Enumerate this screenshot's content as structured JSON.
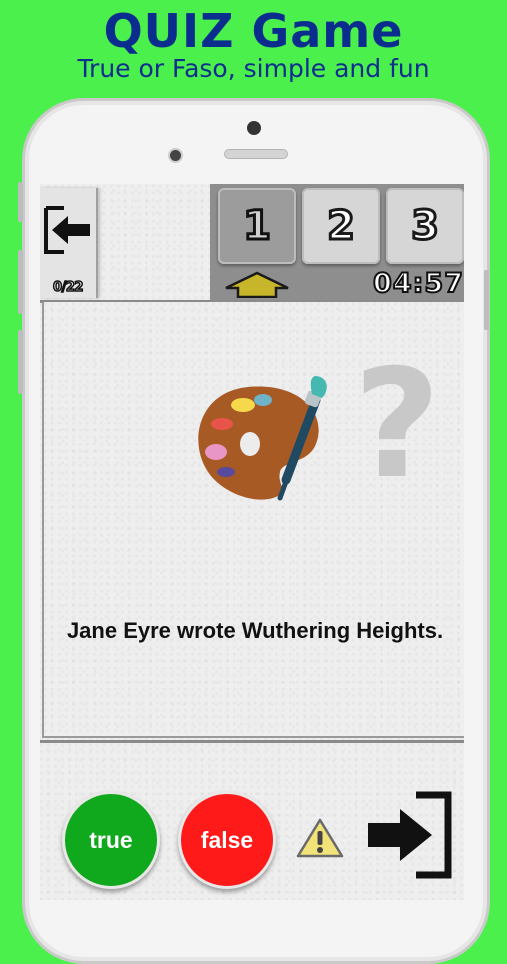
{
  "promo": {
    "title": "QUIZ Game",
    "subtitle": "True or Faso, simple and fun"
  },
  "game": {
    "progress": "0/22",
    "levels": [
      "1",
      "2",
      "3"
    ],
    "active_level": "1",
    "timer": "04:57",
    "question": "Jane Eyre wrote Wuthering Heights.",
    "illustration": "paint-palette-icon",
    "hint_symbol": "?"
  },
  "actions": {
    "true_label": "true",
    "false_label": "false",
    "report_icon": "warning-icon",
    "exit_icon": "exit-icon",
    "back_icon": "back-arrow-icon"
  },
  "colors": {
    "background": "#4cf04c",
    "title": "#0b2d8e",
    "true": "#10a81d",
    "false": "#ff1a1a",
    "level_arrow": "#c7b52a"
  }
}
